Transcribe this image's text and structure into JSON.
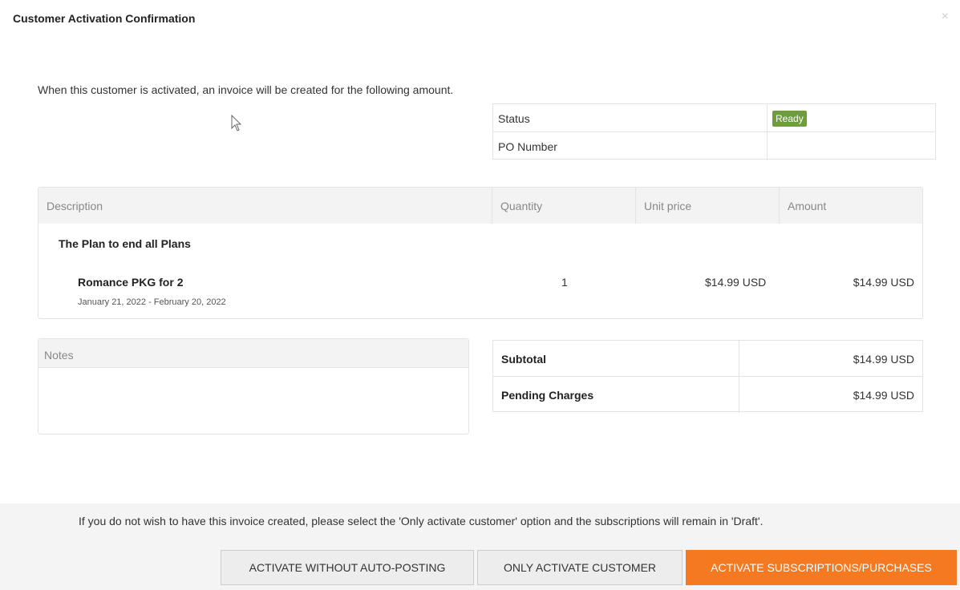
{
  "dialog": {
    "title": "Customer Activation Confirmation",
    "close_label": "×"
  },
  "intro_text": "When this customer is activated, an invoice will be created for the following amount.",
  "status_table": {
    "status_label": "Status",
    "status_value": "Ready",
    "po_label": "PO Number",
    "po_value": ""
  },
  "items_table": {
    "headers": [
      "Description",
      "Quantity",
      "Unit price",
      "Amount"
    ],
    "plan_name": "The Plan to end all Plans",
    "items": [
      {
        "name": "Romance PKG for 2",
        "dates": "January 21, 2022 - February 20, 2022",
        "quantity": "1",
        "unit_price": "$14.99 USD",
        "amount": "$14.99 USD"
      }
    ]
  },
  "notes": {
    "label": "Notes",
    "content": ""
  },
  "totals": {
    "subtotal_label": "Subtotal",
    "subtotal_value": "$14.99 USD",
    "pending_label": "Pending Charges",
    "pending_value": "$14.99 USD"
  },
  "footer": {
    "message": "If you do not wish to have this invoice created, please select the 'Only activate customer' option and the subscriptions will remain in 'Draft'.",
    "buttons": {
      "without_autopost": "ACTIVATE WITHOUT AUTO-POSTING",
      "only_customer": "ONLY ACTIVATE CUSTOMER",
      "activate_subs": "ACTIVATE SUBSCRIPTIONS/PURCHASES"
    }
  },
  "colors": {
    "status_badge": "#6e9e3b",
    "primary_button": "#f47920"
  }
}
